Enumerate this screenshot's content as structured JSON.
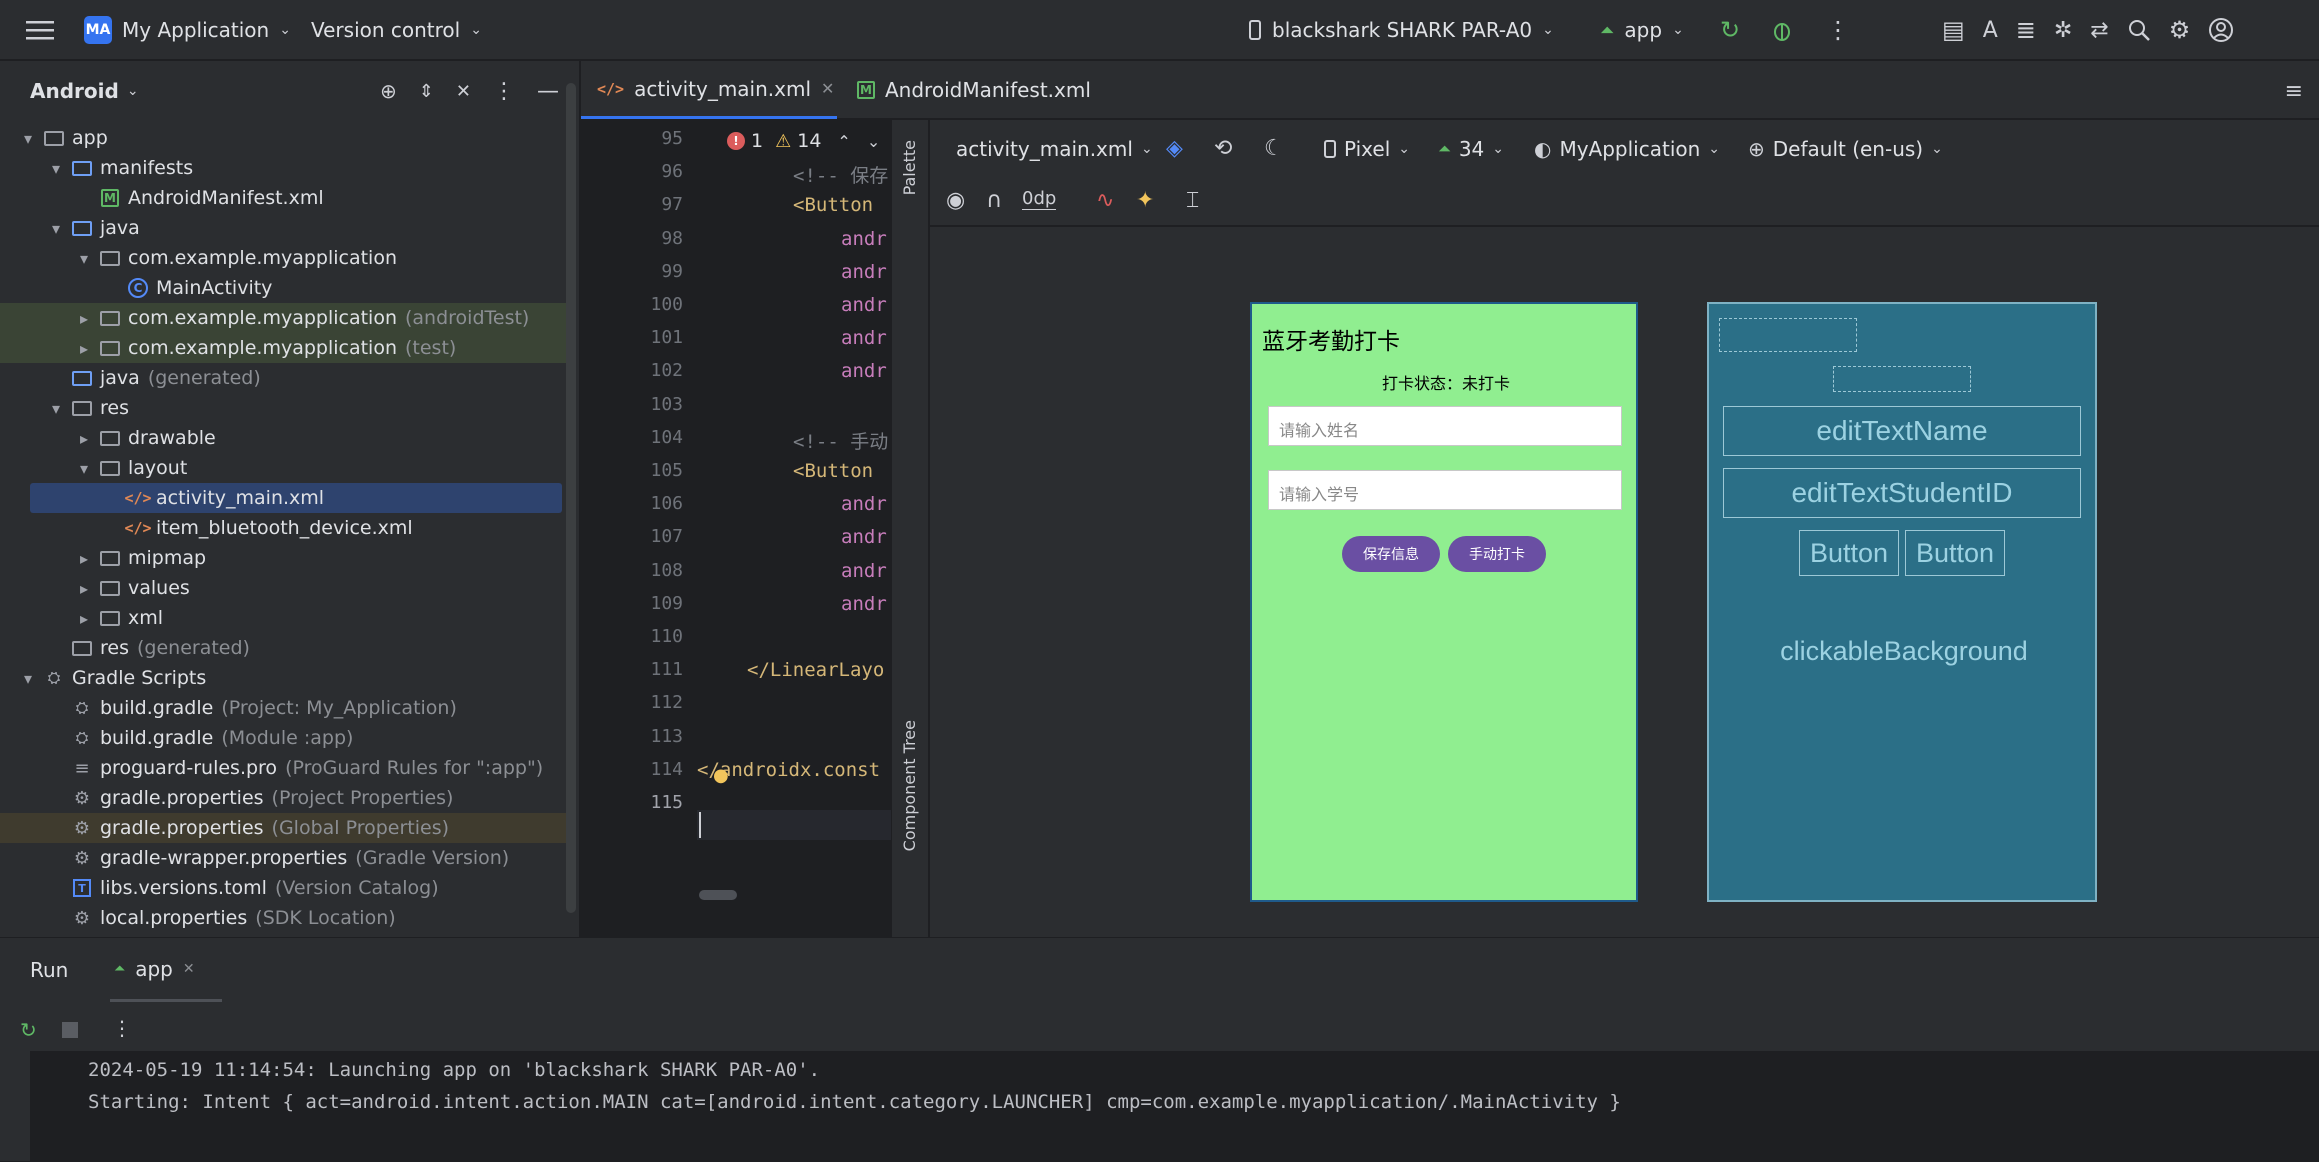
{
  "titlebar": {
    "project_badge": "MA",
    "project_name": "My Application",
    "vcs": "Version control",
    "device": "blackshark SHARK PAR-A0",
    "run_config": "app"
  },
  "project_panel": {
    "view": "Android",
    "tree": [
      {
        "label": "app",
        "hint": "",
        "level": 0,
        "chev": "▾",
        "icon": "module"
      },
      {
        "label": "manifests",
        "hint": "",
        "level": 1,
        "chev": "▾",
        "icon": "folder-blue"
      },
      {
        "label": "AndroidManifest.xml",
        "hint": "",
        "level": 2,
        "chev": "",
        "icon": "manifest"
      },
      {
        "label": "java",
        "hint": "",
        "level": 1,
        "chev": "▾",
        "icon": "folder-blue"
      },
      {
        "label": "com.example.myapplication",
        "hint": "",
        "level": 2,
        "chev": "▾",
        "icon": "package"
      },
      {
        "label": "MainActivity",
        "hint": "",
        "level": 3,
        "chev": "",
        "icon": "class"
      },
      {
        "label": "com.example.myapplication",
        "hint": "(androidTest)",
        "level": 2,
        "chev": "▸",
        "icon": "package",
        "highlight": "green"
      },
      {
        "label": "com.example.myapplication",
        "hint": "(test)",
        "level": 2,
        "chev": "▸",
        "icon": "package",
        "highlight": "green"
      },
      {
        "label": "java",
        "hint": "(generated)",
        "level": 1,
        "chev": "",
        "icon": "folder-blue"
      },
      {
        "label": "res",
        "hint": "",
        "level": 1,
        "chev": "▾",
        "icon": "folder"
      },
      {
        "label": "drawable",
        "hint": "",
        "level": 2,
        "chev": "▸",
        "icon": "folder"
      },
      {
        "label": "layout",
        "hint": "",
        "level": 2,
        "chev": "▾",
        "icon": "folder"
      },
      {
        "label": "activity_main.xml",
        "hint": "",
        "level": 3,
        "chev": "",
        "icon": "xml",
        "selected": true
      },
      {
        "label": "item_bluetooth_device.xml",
        "hint": "",
        "level": 3,
        "chev": "",
        "icon": "xml"
      },
      {
        "label": "mipmap",
        "hint": "",
        "level": 2,
        "chev": "▸",
        "icon": "folder"
      },
      {
        "label": "values",
        "hint": "",
        "level": 2,
        "chev": "▸",
        "icon": "folder"
      },
      {
        "label": "xml",
        "hint": "",
        "level": 2,
        "chev": "▸",
        "icon": "folder"
      },
      {
        "label": "res",
        "hint": "(generated)",
        "level": 1,
        "chev": "",
        "icon": "folder"
      },
      {
        "label": "Gradle Scripts",
        "hint": "",
        "level": 0,
        "chev": "▾",
        "icon": "gradle"
      },
      {
        "label": "build.gradle",
        "hint": "(Project: My_Application)",
        "level": 1,
        "chev": "",
        "icon": "gradle"
      },
      {
        "label": "build.gradle",
        "hint": "(Module :app)",
        "level": 1,
        "chev": "",
        "icon": "gradle"
      },
      {
        "label": "proguard-rules.pro",
        "hint": "(ProGuard Rules for \":app\")",
        "level": 1,
        "chev": "",
        "icon": "text"
      },
      {
        "label": "gradle.properties",
        "hint": "(Project Properties)",
        "level": 1,
        "chev": "",
        "icon": "settings"
      },
      {
        "label": "gradle.properties",
        "hint": "(Global Properties)",
        "level": 1,
        "chev": "",
        "icon": "settings",
        "highlight": "yellow"
      },
      {
        "label": "gradle-wrapper.properties",
        "hint": "(Gradle Version)",
        "level": 1,
        "chev": "",
        "icon": "settings"
      },
      {
        "label": "libs.versions.toml",
        "hint": "(Version Catalog)",
        "level": 1,
        "chev": "",
        "icon": "toml"
      },
      {
        "label": "local.properties",
        "hint": "(SDK Location)",
        "level": 1,
        "chev": "",
        "icon": "settings"
      }
    ]
  },
  "editor": {
    "tabs": [
      {
        "label": "activity_main.xml",
        "active": true
      },
      {
        "label": "AndroidManifest.xml",
        "active": false
      }
    ],
    "errors": "1",
    "warnings": "14",
    "line_numbers": [
      "95",
      "96",
      "97",
      "98",
      "99",
      "100",
      "101",
      "102",
      "103",
      "104",
      "105",
      "106",
      "107",
      "108",
      "109",
      "110",
      "111",
      "112",
      "113",
      "114",
      "115"
    ],
    "code_lines": [
      {
        "n": "96",
        "text": "<!-- 保存",
        "cls": "cmt",
        "indent": 96
      },
      {
        "n": "97",
        "text": "<Button",
        "cls": "tag",
        "indent": 96
      },
      {
        "n": "98",
        "text": "andr",
        "cls": "ns",
        "indent": 144
      },
      {
        "n": "99",
        "text": "andr",
        "cls": "ns",
        "indent": 144
      },
      {
        "n": "100",
        "text": "andr",
        "cls": "ns",
        "indent": 144
      },
      {
        "n": "101",
        "text": "andr",
        "cls": "ns",
        "indent": 144
      },
      {
        "n": "102",
        "text": "andr",
        "cls": "ns",
        "indent": 144
      },
      {
        "n": "104",
        "text": "<!-- 手动",
        "cls": "cmt",
        "indent": 96
      },
      {
        "n": "105",
        "text": "<Button",
        "cls": "tag",
        "indent": 96
      },
      {
        "n": "106",
        "text": "andr",
        "cls": "ns",
        "indent": 144
      },
      {
        "n": "107",
        "text": "andr",
        "cls": "ns",
        "indent": 144
      },
      {
        "n": "108",
        "text": "andr",
        "cls": "ns",
        "indent": 144
      },
      {
        "n": "109",
        "text": "andr",
        "cls": "ns",
        "indent": 144
      },
      {
        "n": "111",
        "text": "</LinearLayo",
        "cls": "tag",
        "indent": 50
      },
      {
        "n": "114",
        "text": "</androidx.const",
        "cls": "tag",
        "indent": 0
      }
    ],
    "side_palette": "Palette",
    "side_tree": "Component Tree"
  },
  "design": {
    "file": "activity_main.xml",
    "device": "Pixel",
    "api": "34",
    "theme": "MyApplication",
    "locale": "Default (en-us)",
    "margin": "0dp"
  },
  "phone": {
    "title": "蓝牙考勤打卡",
    "status": "打卡状态：未打卡",
    "name_placeholder": "请输入姓名",
    "id_placeholder": "请输入学号",
    "save_btn": "保存信息",
    "checkin_btn": "手动打卡",
    "bg_color": "#90ee90",
    "button_color": "#6a4fa3"
  },
  "blueprint": {
    "edit_name": "editTextName",
    "edit_id": "editTextStudentID",
    "btn1": "Button",
    "btn2": "Button",
    "clickable": "clickableBackground"
  },
  "run": {
    "tab_run": "Run",
    "tab_app": "app",
    "lines": [
      "2024-05-19 11:14:54: Launching app on 'blackshark SHARK PAR-A0'.",
      "Starting: Intent { act=android.intent.action.MAIN cat=[android.intent.category.LAUNCHER] cmp=com.example.myapplication/.MainActivity }"
    ]
  }
}
